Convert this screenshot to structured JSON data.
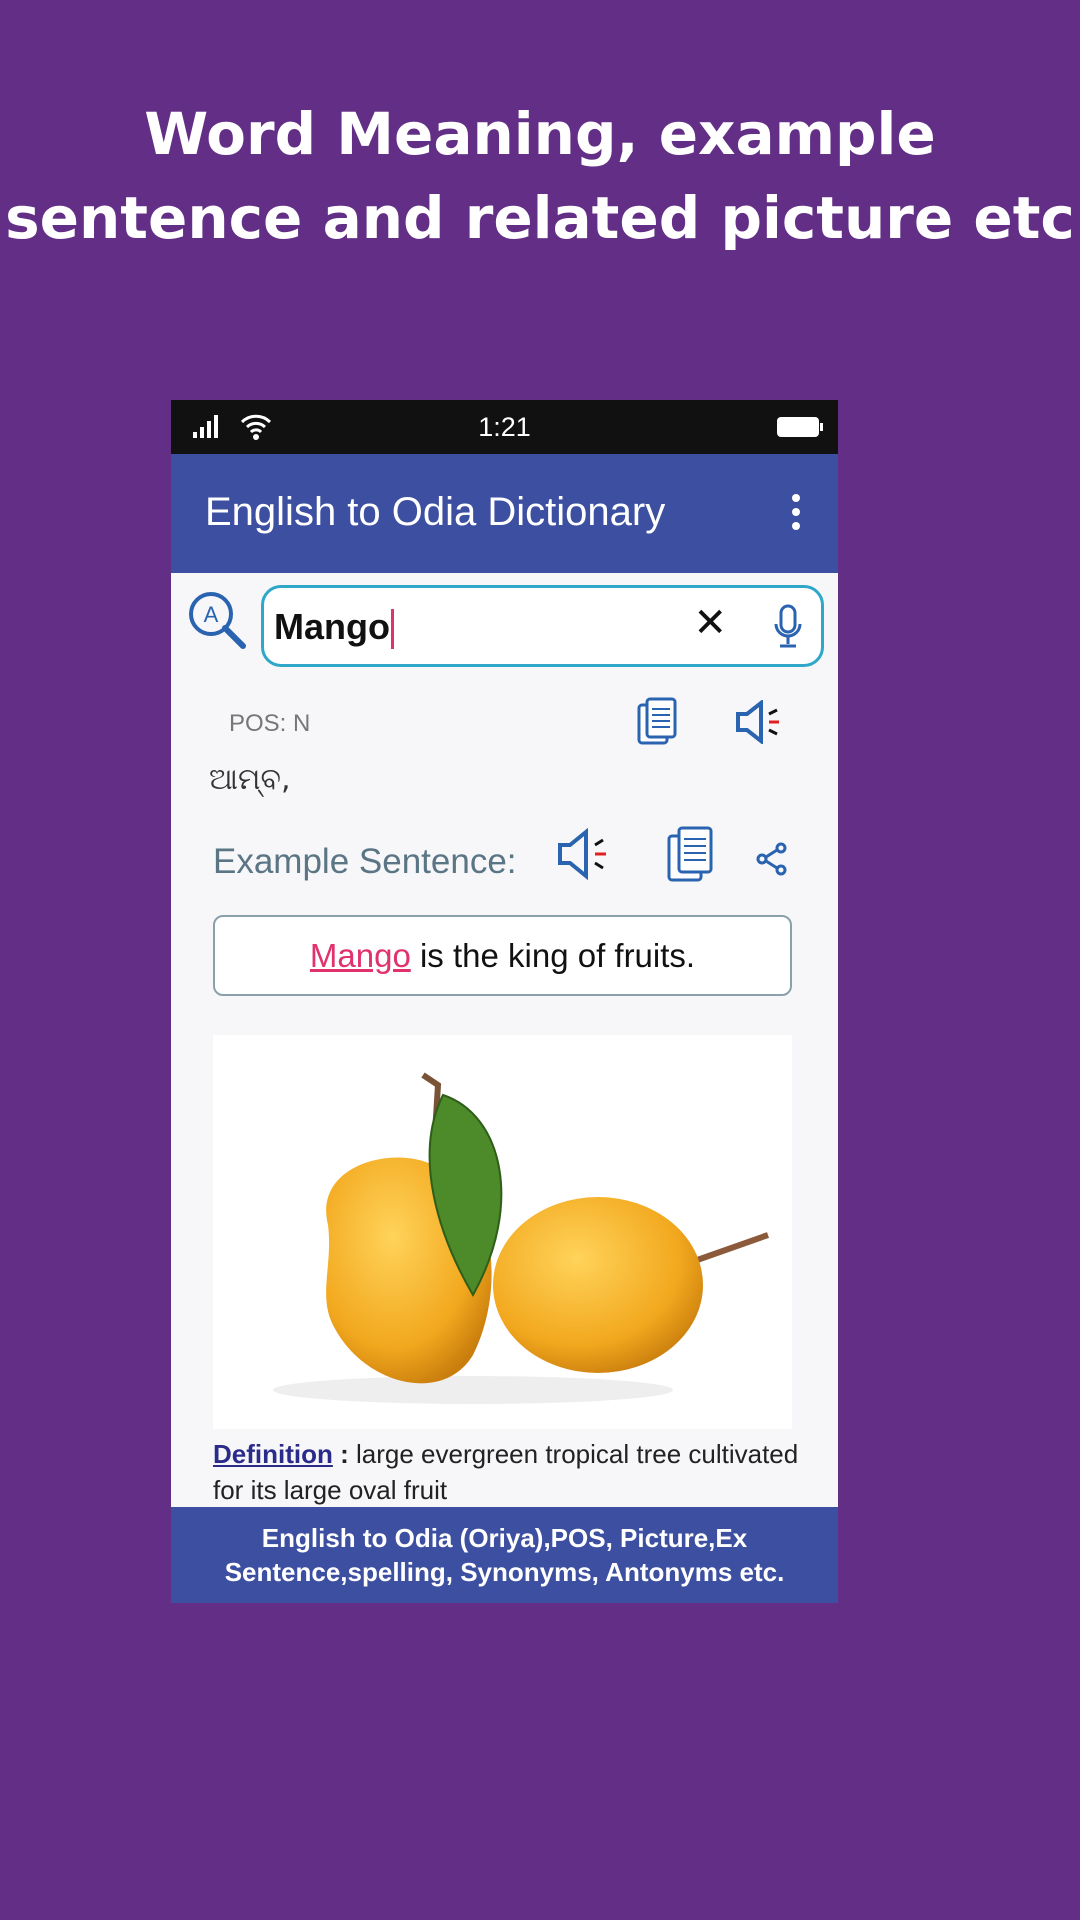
{
  "headline": {
    "line1": "Word Meaning, example",
    "line2": "sentence and related picture etc"
  },
  "status_bar": {
    "time": "1:21",
    "icons": [
      "signal-icon",
      "wifi-icon",
      "battery-icon"
    ]
  },
  "app_bar": {
    "title": "English to Odia Dictionary",
    "menu_icon": "more-vert-icon"
  },
  "search": {
    "value": "Mango",
    "clear_icon": "close-icon",
    "voice_icon": "mic-icon"
  },
  "result": {
    "pos": "POS: N",
    "meaning": "ଆମ୍ବ,",
    "example_label": "Example Sentence:",
    "sentence_word": "Mango",
    "sentence_rest": " is the king of fruits.",
    "definition_label": "Definition",
    "definition_sep": " : ",
    "definition_text": "large evergreen tropical tree cultivated for its large oval fruit"
  },
  "banner": {
    "line1": "English to Odia (Oriya),POS, Picture,Ex",
    "line2": "Sentence,spelling, Synonyms, Antonyms etc."
  },
  "colors": {
    "background": "#632f86",
    "app_bar": "#3d4fa0",
    "accent": "#e0336c",
    "icon": "#2a63b0"
  }
}
